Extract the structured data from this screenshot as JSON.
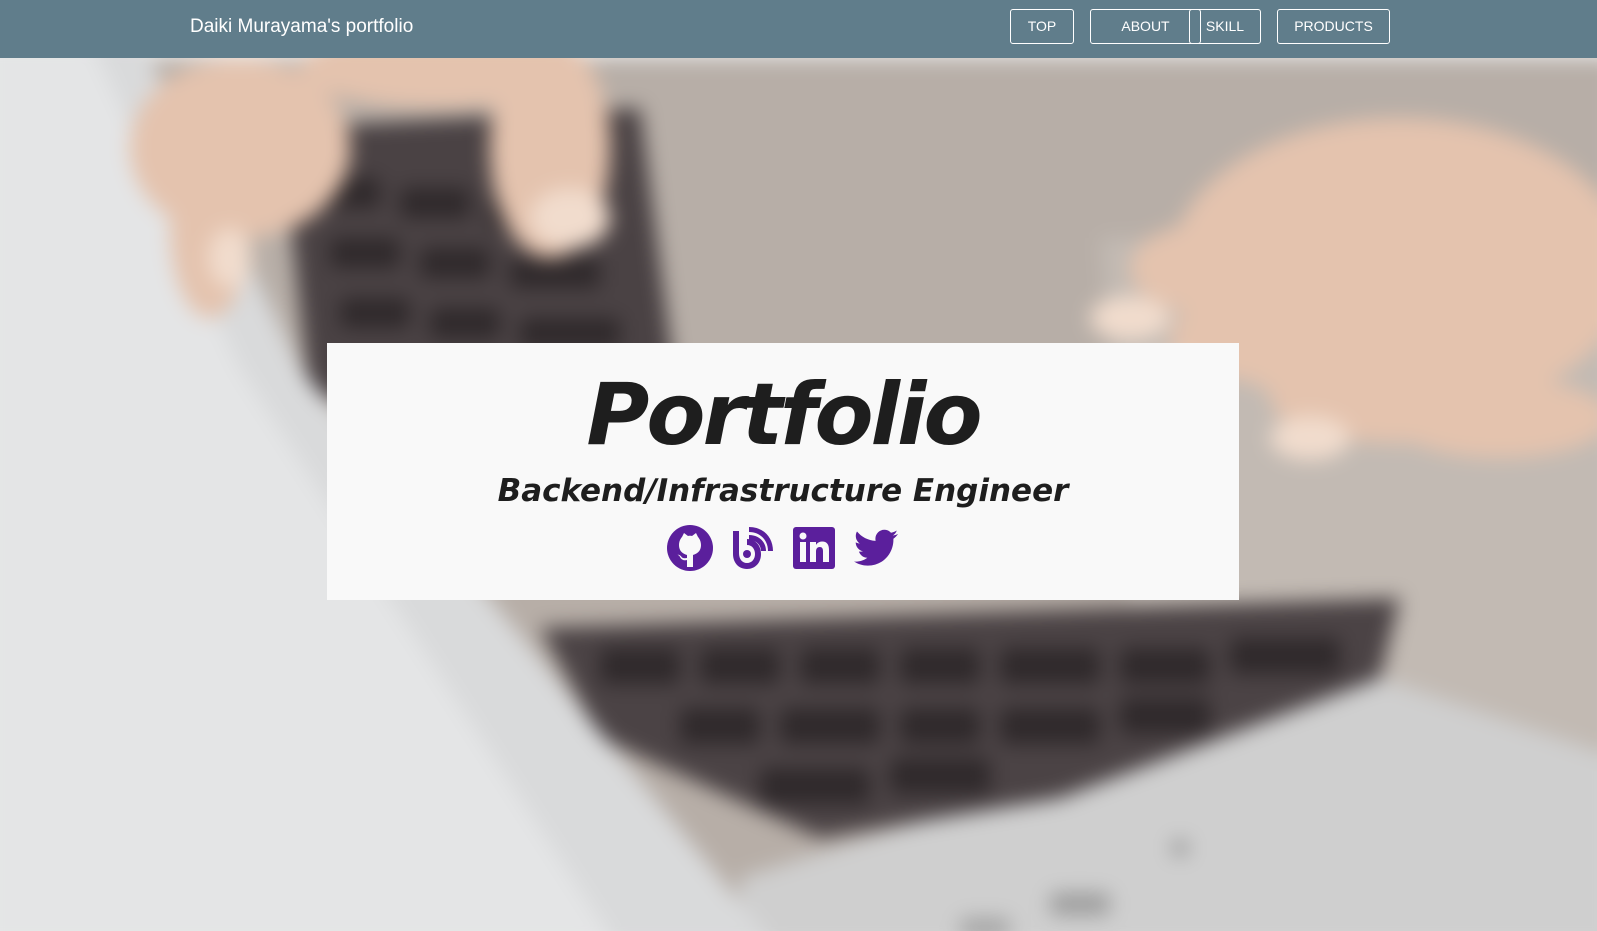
{
  "navbar": {
    "brand": "Daiki Murayama's portfolio",
    "items": [
      {
        "label": "TOP"
      },
      {
        "label": "ABOUT"
      },
      {
        "label": "SKILL"
      },
      {
        "label": "PRODUCTS"
      }
    ],
    "background_color": "#607d8b"
  },
  "hero": {
    "title": "Portfolio",
    "subtitle": "Backend/Infrastructure Engineer",
    "icon_color": "#5b1f9c",
    "social_links": [
      {
        "icon": "github-icon"
      },
      {
        "icon": "blog-icon"
      },
      {
        "icon": "linkedin-icon"
      },
      {
        "icon": "twitter-icon"
      }
    ]
  }
}
